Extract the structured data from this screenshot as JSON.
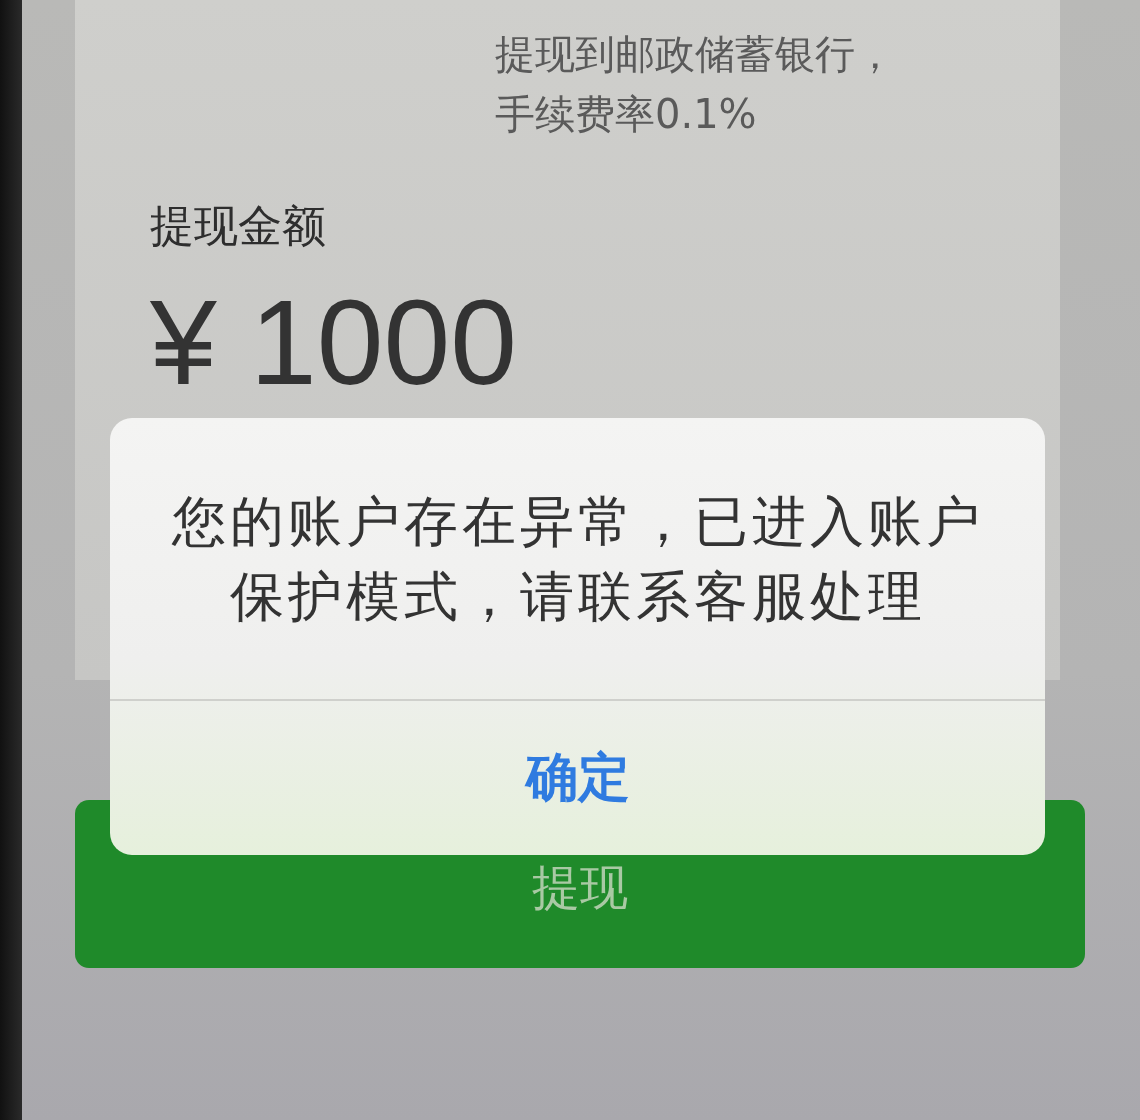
{
  "withdraw_form": {
    "fee_note": "提现到邮政储蓄银行，手续费率0.1%",
    "amount_label": "提现金额",
    "amount_value": "¥ 1000",
    "submit_button": {
      "label": "提现"
    }
  },
  "alert": {
    "message": "您的账户存在异常，已进入账户保护模式，请联系客服处理",
    "buttons": [
      {
        "label": "确定",
        "kind": "primary"
      }
    ]
  }
}
